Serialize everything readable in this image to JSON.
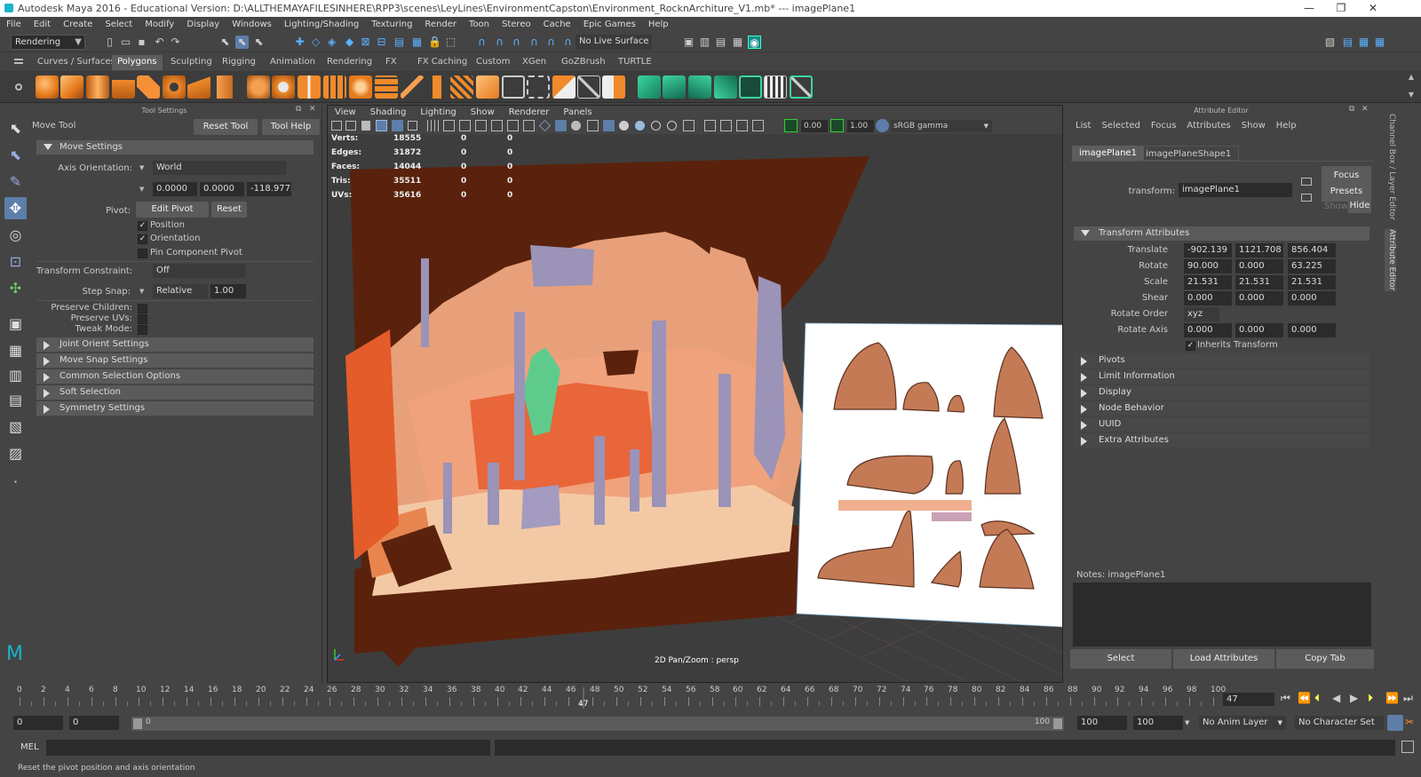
{
  "title": "Autodesk Maya 2016 - Educational Version: D:\\ALLTHEMAYAFILESINHERE\\RPP3\\scenes\\LeyLines\\EnvironmentCapston\\Environment_RocknArchiture_V1.mb*  ---  imagePlane1",
  "window_controls": {
    "minimize": "—",
    "restore": "❐",
    "close": "✕"
  },
  "menus": [
    "File",
    "Edit",
    "Create",
    "Select",
    "Modify",
    "Display",
    "Windows",
    "Lighting/Shading",
    "Texturing",
    "Render",
    "Toon",
    "Stereo",
    "Cache",
    "Epic Games",
    "Help"
  ],
  "status_line": {
    "menu_set": "Rendering",
    "live_surface": "No Live Surface"
  },
  "shelf_tabs": [
    "Curves / Surfaces",
    "Polygons",
    "Sculpting",
    "Rigging",
    "Animation",
    "Rendering",
    "FX",
    "FX Caching",
    "Custom",
    "XGen",
    "GoZBrush",
    "TURTLE"
  ],
  "shelf_active": "Polygons",
  "tool_settings": {
    "header": "Tool Settings",
    "tool_name": "Move Tool",
    "reset_tool": "Reset Tool",
    "tool_help": "Tool Help",
    "move_settings": "Move Settings",
    "axis_orientation_label": "Axis Orientation:",
    "axis_orientation": "World",
    "axis_values": [
      "0.0000",
      "0.0000",
      "-118.9772"
    ],
    "pivot_label": "Pivot:",
    "edit_pivot": "Edit Pivot",
    "reset": "Reset",
    "position": "Position",
    "orientation": "Orientation",
    "pin_component_pivot": "Pin Component Pivot",
    "transform_constraint_label": "Transform Constraint:",
    "transform_constraint": "Off",
    "step_snap_label": "Step Snap:",
    "step_snap_mode": "Relative",
    "step_snap_value": "1.00",
    "preserve_children": "Preserve Children:",
    "preserve_uvs": "Preserve UVs:",
    "tweak_mode": "Tweak Mode:",
    "frames": [
      "Joint Orient Settings",
      "Move Snap Settings",
      "Common Selection Options",
      "Soft Selection",
      "Symmetry Settings"
    ]
  },
  "viewport": {
    "menus": [
      "View",
      "Shading",
      "Lighting",
      "Show",
      "Renderer",
      "Panels"
    ],
    "exposure": "0.00",
    "gamma": "1.00",
    "color_space": "sRGB gamma",
    "hud": [
      {
        "label": "Verts:",
        "a": "18555",
        "b": "0",
        "c": "0"
      },
      {
        "label": "Edges:",
        "a": "31872",
        "b": "0",
        "c": "0"
      },
      {
        "label": "Faces:",
        "a": "14044",
        "b": "0",
        "c": "0"
      },
      {
        "label": "Tris:",
        "a": "35511",
        "b": "0",
        "c": "0"
      },
      {
        "label": "UVs:",
        "a": "35616",
        "b": "0",
        "c": "0"
      }
    ],
    "camera_label": "2D Pan/Zoom : persp"
  },
  "attribute_editor": {
    "header": "Attribute Editor",
    "menus": [
      "List",
      "Selected",
      "Focus",
      "Attributes",
      "Show",
      "Help"
    ],
    "tabs": [
      "imagePlane1",
      "imagePlaneShape1"
    ],
    "transform_label": "transform:",
    "transform_value": "imagePlane1",
    "focus": "Focus",
    "presets": "Presets",
    "show": "Show",
    "hide": "Hide",
    "transform_attributes": "Transform Attributes",
    "translate_label": "Translate",
    "translate": [
      "-902.139",
      "1121.708",
      "856.404"
    ],
    "rotate_label": "Rotate",
    "rotate": [
      "90.000",
      "0.000",
      "63.225"
    ],
    "scale_label": "Scale",
    "scale": [
      "21.531",
      "21.531",
      "21.531"
    ],
    "shear_label": "Shear",
    "shear": [
      "0.000",
      "0.000",
      "0.000"
    ],
    "rotate_order_label": "Rotate Order",
    "rotate_order": "xyz",
    "rotate_axis_label": "Rotate Axis",
    "rotate_axis": [
      "0.000",
      "0.000",
      "0.000"
    ],
    "inherits_transform": "Inherits Transform",
    "frames": [
      "Pivots",
      "Limit Information",
      "Display",
      "Node Behavior",
      "UUID",
      "Extra Attributes"
    ],
    "notes": "Notes:  imagePlane1",
    "select": "Select",
    "load_attributes": "Load Attributes",
    "copy_tab": "Copy Tab"
  },
  "side_tabs": [
    "Channel Box / Layer Editor",
    "Attribute Editor"
  ],
  "timeline": {
    "ticks": [
      "0",
      "2",
      "4",
      "6",
      "8",
      "10",
      "12",
      "14",
      "16",
      "18",
      "20",
      "22",
      "24",
      "26",
      "28",
      "30",
      "32",
      "34",
      "36",
      "38",
      "40",
      "42",
      "44",
      "46",
      "48",
      "50",
      "52",
      "54",
      "56",
      "58",
      "60",
      "62",
      "64",
      "66",
      "68",
      "70",
      "72",
      "74",
      "76",
      "78",
      "80",
      "82",
      "84",
      "86",
      "88",
      "90",
      "92",
      "94",
      "96",
      "98",
      "100"
    ],
    "current_frame": "47",
    "frame_marker": "47"
  },
  "range": {
    "start": "0",
    "start2": "0",
    "slider_start": "0",
    "slider_end": "100",
    "end": "100",
    "end2": "100",
    "anim_layer": "No Anim Layer",
    "character_set": "No Character Set"
  },
  "command_line": {
    "label": "MEL"
  },
  "help_line": "Reset the pivot position and axis orientation"
}
